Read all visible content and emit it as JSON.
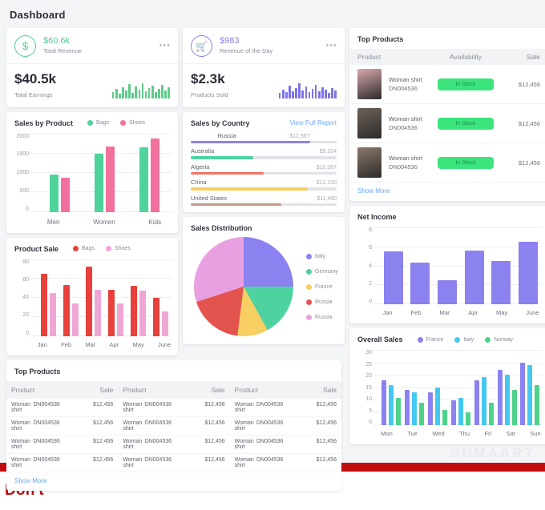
{
  "page": {
    "title": "Dashboard"
  },
  "stats": [
    {
      "icon": "dollar-circle-icon",
      "amount": "$60.6k",
      "label": "Total Revenue",
      "menu": "•••",
      "big": "$40.5k",
      "big_label": "Total Earnings",
      "color": "#58c98b",
      "spark": [
        8,
        12,
        6,
        14,
        10,
        18,
        7,
        15,
        11,
        19,
        9,
        13,
        16,
        8,
        12,
        17,
        10,
        14
      ]
    },
    {
      "icon": "cart-circle-icon",
      "amount": "$983",
      "label": "Revenue of the Day",
      "menu": "•••",
      "big": "$2.3k",
      "big_label": "Products Sold",
      "color": "#7d74e8",
      "spark": [
        7,
        11,
        8,
        16,
        9,
        13,
        19,
        10,
        15,
        8,
        12,
        17,
        9,
        14,
        11,
        7,
        13,
        10
      ]
    }
  ],
  "sales_by_product": {
    "title": "Sales by Product",
    "legend": [
      {
        "label": "Bags",
        "color": "#4fd39a"
      },
      {
        "label": "Shoes",
        "color": "#f2709d"
      }
    ],
    "chart_data": {
      "type": "bar",
      "title": "Sales by Product",
      "categories": [
        "Men",
        "Women",
        "Kids"
      ],
      "series": [
        {
          "name": "Bags",
          "color": "#4fd39a",
          "values": [
            950,
            1480,
            1640
          ]
        },
        {
          "name": "Shoes",
          "color": "#f2709d",
          "values": [
            870,
            1670,
            1870
          ]
        }
      ],
      "yticks": [
        "2000",
        "1500",
        "1000",
        "500",
        "0"
      ],
      "ylim": [
        0,
        2000
      ],
      "xlabel": "",
      "ylabel": "",
      "grid": true,
      "legend_position": "top"
    }
  },
  "sales_by_country": {
    "title": "Sales by Country",
    "link": "View Full Report",
    "chart_data": {
      "type": "bar",
      "title": "Sales by Country",
      "categories": [
        "Russia",
        "Australia",
        "Algeria",
        "China",
        "United States"
      ],
      "values": [
        12567,
        9324,
        10367,
        12100,
        11480
      ],
      "value_labels": [
        "$12,567",
        "$9,324",
        "$10,367",
        "$12,100",
        "$11,480"
      ],
      "percents": [
        82,
        43,
        50,
        80,
        62
      ],
      "colors": [
        "#8b82ef",
        "#4ed3a0",
        "#ef7463",
        "#f7cf62",
        "#c49a8a"
      ],
      "xlabel": "",
      "ylabel": "",
      "grid": false
    }
  },
  "top_products": {
    "title": "Top Products",
    "columns": [
      "Product",
      "Availability",
      "Sale"
    ],
    "rows": [
      {
        "name": "Woman shirt",
        "id": "DN004536",
        "status": "In Stock",
        "price": "$12,456",
        "thumb": "#d8a8ae"
      },
      {
        "name": "Woman shirt",
        "id": "DN004536",
        "status": "In Stock",
        "price": "$12,456",
        "thumb": "#6b6158"
      },
      {
        "name": "Woman shirt",
        "id": "DN004536",
        "status": "In Stock",
        "price": "$12,456",
        "thumb": "#8a7a6b"
      }
    ],
    "show_more": "Show More"
  },
  "net_income": {
    "title": "Net Income",
    "chart_data": {
      "type": "bar",
      "title": "Net Income",
      "categories": [
        "Jan",
        "Feb",
        "Mar",
        "Apr",
        "May",
        "June"
      ],
      "values": [
        5.5,
        4.3,
        2.5,
        5.6,
        4.5,
        6.5
      ],
      "color": "#8b82ef",
      "yticks": [
        "8",
        "6",
        "4",
        "2",
        "0"
      ],
      "ylim": [
        0,
        8
      ],
      "xlabel": "",
      "ylabel": "",
      "grid": true
    }
  },
  "product_sale": {
    "title": "Product Sale",
    "legend": [
      {
        "label": "Bags",
        "color": "#e8413c"
      },
      {
        "label": "Shoes",
        "color": "#f0a6d5"
      }
    ],
    "chart_data": {
      "type": "bar",
      "title": "Product Sale",
      "categories": [
        "Jan",
        "Feb",
        "Mar",
        "Apr",
        "May",
        "June"
      ],
      "series": [
        {
          "name": "Bags",
          "color": "#e8413c",
          "values": [
            65,
            53,
            72,
            48,
            52,
            40
          ]
        },
        {
          "name": "Shoes",
          "color": "#f0a6d5",
          "values": [
            45,
            34,
            48,
            34,
            47,
            26
          ]
        }
      ],
      "yticks": [
        "80",
        "60",
        "40",
        "20",
        "0"
      ],
      "ylim": [
        0,
        80
      ],
      "xlabel": "",
      "ylabel": "",
      "grid": true,
      "legend_position": "top"
    }
  },
  "sales_distribution": {
    "title": "Sales Distribution",
    "chart_data": {
      "type": "pie",
      "title": "Sales Distribution",
      "labels": [
        "Italy",
        "Germany",
        "France",
        "Russia",
        "Russia"
      ],
      "values": [
        25,
        17,
        10,
        18,
        30
      ],
      "colors": [
        "#8b82ef",
        "#4ed3a0",
        "#f7cf62",
        "#e4544f",
        "#e9a0e0"
      ],
      "legend_position": "right"
    }
  },
  "overall_sales": {
    "title": "Overall Sales",
    "legend": [
      {
        "label": "France",
        "color": "#8b82ef"
      },
      {
        "label": "Italy",
        "color": "#45c8ef"
      },
      {
        "label": "Norway",
        "color": "#4ed38a"
      }
    ],
    "chart_data": {
      "type": "bar",
      "title": "Overall Sales",
      "categories": [
        "Mon",
        "Tue",
        "Wed",
        "Thu",
        "Fri",
        "Sat",
        "Sun"
      ],
      "series": [
        {
          "name": "France",
          "color": "#8b82ef",
          "values": [
            18,
            14,
            13,
            10,
            18,
            22,
            25
          ]
        },
        {
          "name": "Italy",
          "color": "#45c8ef",
          "values": [
            16,
            13,
            15,
            11,
            19,
            20,
            24
          ]
        },
        {
          "name": "Norway",
          "color": "#4ed38a",
          "values": [
            11,
            9,
            6,
            5,
            9,
            14,
            16
          ]
        }
      ],
      "yticks": [
        "30",
        "25",
        "20",
        "15",
        "10",
        "5",
        "0"
      ],
      "ylim": [
        0,
        30
      ],
      "xlabel": "",
      "ylabel": "",
      "grid": true,
      "legend_position": "top"
    }
  },
  "bottom_products": {
    "title": "Top Products",
    "columns": [
      "Product",
      "Sale"
    ],
    "groups": [
      {
        "rows": [
          {
            "name": "Woman shirt",
            "id": "DN004536",
            "sale": "$12,456"
          },
          {
            "name": "Woman shirt",
            "id": "DN004536",
            "sale": "$12,456"
          },
          {
            "name": "Woman shirt",
            "id": "DN004536",
            "sale": "$12,456"
          },
          {
            "name": "Woman shirt",
            "id": "DN004536",
            "sale": "$12,456"
          }
        ]
      },
      {
        "rows": [
          {
            "name": "Woman shirt",
            "id": "DN004536",
            "sale": "$12,456"
          },
          {
            "name": "Woman shirt",
            "id": "DN004536",
            "sale": "$12,456"
          },
          {
            "name": "Woman shirt",
            "id": "DN004536",
            "sale": "$12,456"
          },
          {
            "name": "Woman shirt",
            "id": "DN004536",
            "sale": "$12,456"
          }
        ]
      },
      {
        "rows": [
          {
            "name": "Woman shirt",
            "id": "DN004536",
            "sale": "$12,456"
          },
          {
            "name": "Woman shirt",
            "id": "DN004536",
            "sale": "$12,456"
          },
          {
            "name": "Woman shirt",
            "id": "DN004536",
            "sale": "$12,456"
          },
          {
            "name": "Woman shirt",
            "id": "DN004536",
            "sale": "$12,456"
          }
        ]
      }
    ],
    "show_more": "Show More"
  },
  "watermark": "SUMAART",
  "footer": {
    "caption": "Don't",
    "bar_color": "#c00d0d"
  }
}
